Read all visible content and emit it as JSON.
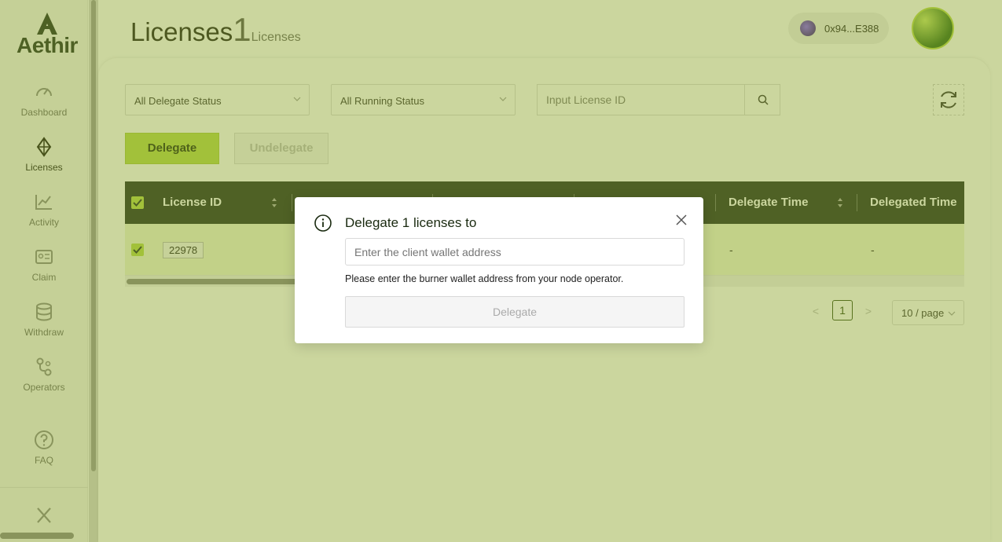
{
  "brand": {
    "logo_text": "Aethir"
  },
  "sidebar": {
    "items": [
      {
        "label": "Dashboard",
        "icon": "gauge-icon"
      },
      {
        "label": "Licenses",
        "icon": "diamond-icon"
      },
      {
        "label": "Activity",
        "icon": "chart-line-icon"
      },
      {
        "label": "Claim",
        "icon": "id-card-icon"
      },
      {
        "label": "Withdraw",
        "icon": "database-icon"
      },
      {
        "label": "Operators",
        "icon": "link-nodes-icon"
      },
      {
        "label": "FAQ",
        "icon": "question-icon"
      }
    ],
    "active": "Licenses"
  },
  "header": {
    "title": "Licenses",
    "count": "1",
    "sub": "Licenses",
    "wallet": "0x94...E388"
  },
  "filters": {
    "delegate_status": "All Delegate Status",
    "running_status": "All Running Status",
    "search_placeholder": "Input License ID"
  },
  "actions": {
    "delegate_label": "Delegate",
    "undelegate_label": "Undelegate"
  },
  "table": {
    "columns": [
      "License ID",
      "",
      "",
      "",
      "Delegate Time",
      "Delegated Time"
    ],
    "rows": [
      {
        "license_id": "22978",
        "delegate_time": "-",
        "delegated_time": "-"
      }
    ]
  },
  "pagination": {
    "prev": "<",
    "current": "1",
    "next": ">",
    "page_size": "10 / page"
  },
  "modal": {
    "title": "Delegate 1 licenses to",
    "input_placeholder": "Enter the client wallet address",
    "hint": "Please enter the burner wallet address from your node operator.",
    "button_label": "Delegate"
  },
  "colors": {
    "accent": "#b4d94a",
    "header_dark": "#1e2b23"
  }
}
